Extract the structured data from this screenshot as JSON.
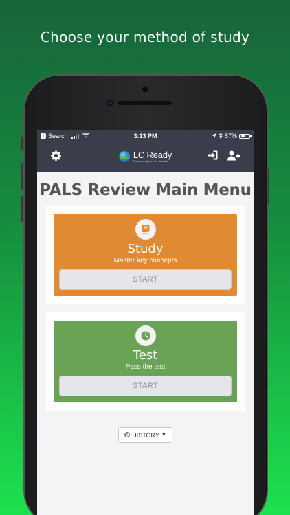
{
  "headline": "Choose your method of study",
  "status_bar": {
    "back_label": "Search",
    "time": "3:13 PM",
    "battery": "57%",
    "battery_level": 0.57
  },
  "nav": {
    "logo_title": "LC Ready",
    "logo_subtitle": "Powered by Limmer Creative",
    "icons": [
      "gear-icon",
      "sign-in-icon",
      "add-user-icon"
    ]
  },
  "page_title": "PALS Review Main Menu",
  "study": {
    "title": "Study",
    "subtitle": "Master key concepts",
    "button": "START",
    "icon": "book-icon",
    "color": "#e08a33"
  },
  "test": {
    "title": "Test",
    "subtitle": "Pass the test",
    "button": "START",
    "icon": "clock-icon",
    "color": "#6aa355"
  },
  "history": {
    "label": "HISTORY"
  },
  "colors": {
    "navbar": "#3a3d4a",
    "background_top": "#17633a",
    "background_bottom": "#1de24f"
  }
}
